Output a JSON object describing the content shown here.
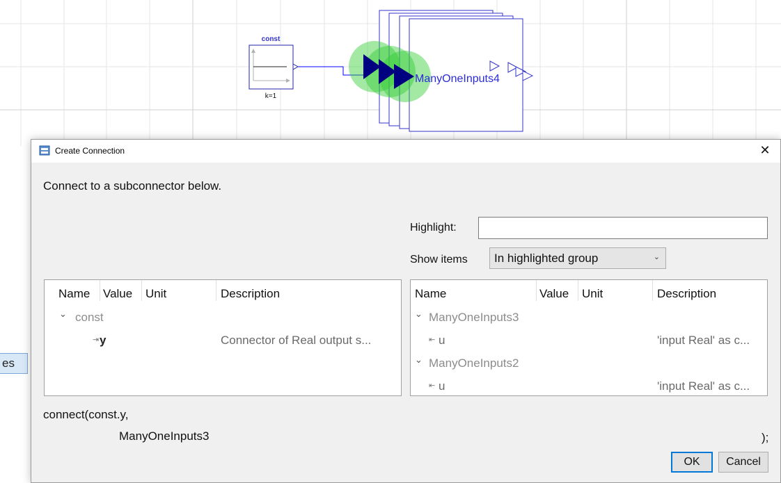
{
  "diagram": {
    "const_block": {
      "name": "const",
      "param": "k=1"
    },
    "target_block": {
      "name": "ManyOneInputs4"
    },
    "colors": {
      "connector": "#0000ff",
      "highlight": "#33cc33",
      "input_arrow": "#000080"
    }
  },
  "background_tab": {
    "label": "es"
  },
  "dialog": {
    "title": "Create Connection",
    "close_icon": "close-icon",
    "instruction": "Connect to a subconnector below.",
    "highlight": {
      "label": "Highlight:",
      "value": ""
    },
    "show_items": {
      "label": "Show items",
      "selected": "In highlighted group"
    },
    "columns": [
      "Name",
      "Value",
      "Unit",
      "Description"
    ],
    "left_tree": {
      "group": "const",
      "child": {
        "name": "y",
        "description": "Connector of Real output s...",
        "icon": "output-connector-icon"
      }
    },
    "right_tree": [
      {
        "group": "ManyOneInputs3",
        "child": {
          "name": "u",
          "description": "'input Real' as c...",
          "icon": "input-connector-icon"
        }
      },
      {
        "group": "ManyOneInputs2",
        "child": {
          "name": "u",
          "description": "'input Real' as c...",
          "icon": "input-connector-icon"
        }
      }
    ],
    "code": {
      "line1": "connect(const.y,",
      "line2": "ManyOneInputs3",
      "end": ");"
    },
    "buttons": {
      "ok": "OK",
      "cancel": "Cancel"
    }
  }
}
